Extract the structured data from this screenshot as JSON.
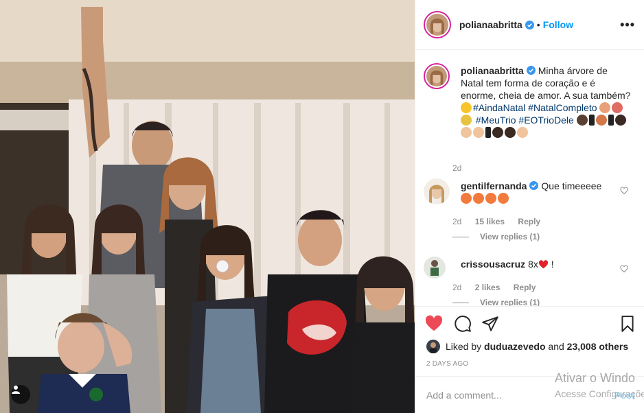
{
  "post": {
    "image_alt": "Family photo in front of curtains",
    "user_tag_icon": "person-icon"
  },
  "header": {
    "username": "polianaabritta",
    "separator": "•",
    "follow_label": "Follow",
    "more_label": "•••"
  },
  "caption": {
    "username": "polianaabritta",
    "text_1": "Minha árvore de Natal tem forma de coração e é enorme, cheia de amor. A sua também?",
    "hashtag_1": "#AindaNatal",
    "hashtag_2": "#NatalCompleto",
    "hashtag_3": "#MeuTrio",
    "hashtag_4": "#EOTrioDele",
    "age": "2d"
  },
  "comments": [
    {
      "username": "gentilfernanda",
      "text": "Que timeeeee",
      "age": "2d",
      "likes": "15 likes",
      "reply": "Reply",
      "view_replies": "View replies (1)"
    },
    {
      "username": "crissousacruz",
      "text": "8x",
      "text_after": "!",
      "age": "2d",
      "likes": "2 likes",
      "reply": "Reply",
      "view_replies": "View replies (1)"
    }
  ],
  "actions": {
    "liked_by_prefix": "Liked by",
    "liked_by_user": "duduazevedo",
    "liked_by_and": "and",
    "liked_by_count": "23,008 others",
    "timestamp": "2 DAYS AGO"
  },
  "add_comment": {
    "placeholder": "Add a comment...",
    "post_label": "Post"
  },
  "watermark": {
    "line1": "Ativar o Windo",
    "line2": "Acesse Configurações"
  },
  "colors": {
    "accent": "#0095f6",
    "like_red": "#ed4956",
    "hashtag": "#00376b",
    "muted": "#8e8e8e"
  }
}
